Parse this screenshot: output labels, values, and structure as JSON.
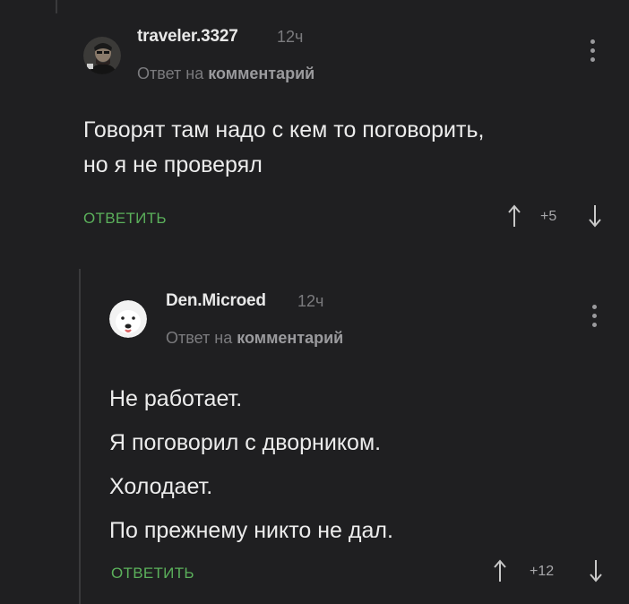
{
  "comments": [
    {
      "username": "traveler.3327",
      "time": "12ч",
      "reply_prefix": "Ответ на",
      "reply_link": "комментарий",
      "lines": [
        "Говорят там надо с кем то поговорить,",
        "но я не проверял"
      ],
      "reply_label": "ОТВЕТИТЬ",
      "score": "+5"
    },
    {
      "username": "Den.Micrоed",
      "time": "12ч",
      "reply_prefix": "Ответ на",
      "reply_link": "комментарий",
      "lines": [
        "Не работает.",
        "Я поговорил с дворником.",
        "Холодает.",
        "По прежнему никто не дал."
      ],
      "reply_label": "ОТВЕТИТЬ",
      "score": "+12"
    }
  ],
  "colors": {
    "background": "#1f1f21",
    "accent_green": "#5bb05b",
    "muted": "#7b7b7e"
  },
  "icons": [
    "avatar-man-icon",
    "avatar-dog-icon",
    "more-vertical-icon",
    "arrow-up-icon",
    "arrow-down-icon"
  ]
}
